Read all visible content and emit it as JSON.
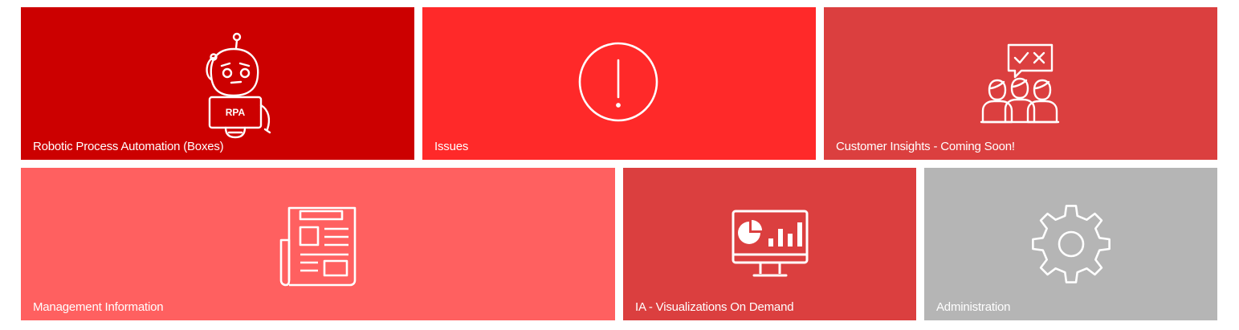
{
  "tiles": [
    {
      "label": "Robotic Process Automation (Boxes)",
      "color": "#cc0000",
      "icon": "robot-rpa-icon",
      "icon_text": "RPA"
    },
    {
      "label": "Issues",
      "color": "#ff2929",
      "icon": "exclamation-circle-icon"
    },
    {
      "label": "Customer Insights - Coming Soon!",
      "color": "#db3f3f",
      "icon": "customer-feedback-icon"
    },
    {
      "label": "Management Information",
      "color": "#ff6060",
      "icon": "newspaper-icon"
    },
    {
      "label": "IA - Visualizations On Demand",
      "color": "#db3f3f",
      "icon": "dashboard-monitor-icon"
    },
    {
      "label": "Administration",
      "color": "#b5b5b5",
      "icon": "gear-icon"
    }
  ]
}
